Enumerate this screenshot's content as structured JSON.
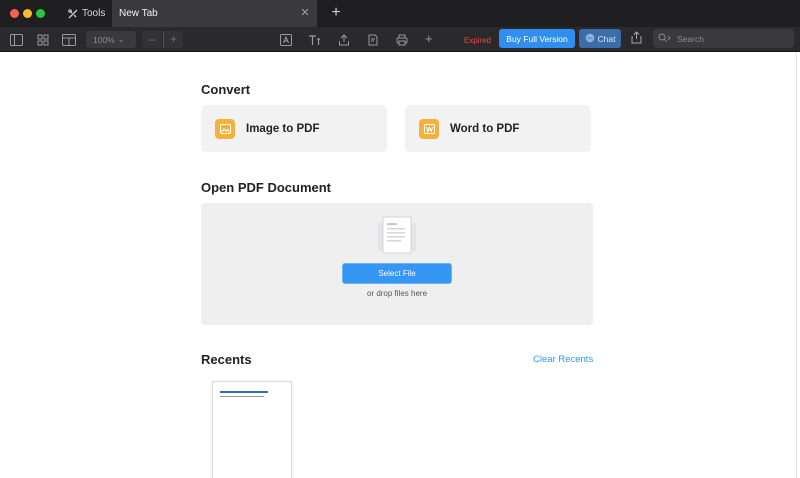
{
  "window": {
    "tabs": [
      {
        "label": "Tools",
        "icon": "tools-icon"
      },
      {
        "label": "New Tab"
      }
    ],
    "new_tab_symbol": "+",
    "close_symbol": "✕"
  },
  "toolbar": {
    "zoom_value": "100%",
    "zoom_minus": "–",
    "zoom_plus": "+",
    "add_symbol": "+",
    "expired_label": "Expired",
    "buy_label": "Buy Full Version",
    "chat_label": "Chat",
    "search_placeholder": "Search",
    "colors": {
      "expired": "#e5454b",
      "buy": "#2f8ff0",
      "chat": "#3b6ea8"
    }
  },
  "convert": {
    "title": "Convert",
    "cards": [
      {
        "label": "Image to PDF",
        "icon": "image-icon"
      },
      {
        "label": "Word to PDF",
        "icon": "word-icon"
      }
    ]
  },
  "open_pdf": {
    "title": "Open PDF Document",
    "select_label": "Select File",
    "drop_hint": "or drop files here"
  },
  "recents": {
    "title": "Recents",
    "clear_label": "Clear Recents"
  }
}
